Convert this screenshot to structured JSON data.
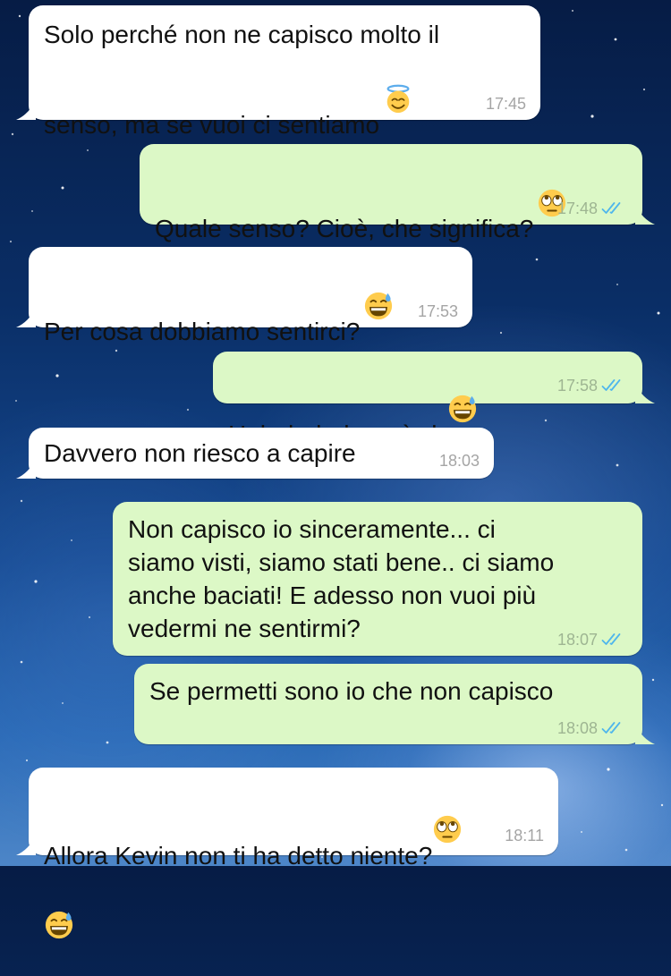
{
  "chat": {
    "messages": [
      {
        "direction": "in",
        "text": "Solo perché non ne capisco molto il\nsenso, ma se vuoi ci sentiamo",
        "emoji_icon": "smiling-face-with-halo",
        "time": "17:45"
      },
      {
        "direction": "out",
        "text": "Quale senso? Cioè, che significa?",
        "emoji_icon": "face-with-rolling-eyes",
        "time": "17:48",
        "status_icon": "double-check-read"
      },
      {
        "direction": "in",
        "text": "Per cosa dobbiamo sentirci?",
        "emoji_icon": "grinning-face-with-sweat",
        "time": "17:53"
      },
      {
        "direction": "out",
        "text": "Hahahahah così ok",
        "emoji_icon": "grinning-face-with-sweat",
        "time": "17:58",
        "status_icon": "double-check-read"
      },
      {
        "direction": "in",
        "text": "Davvero non riesco a capire",
        "time": "18:03"
      },
      {
        "direction": "out",
        "text": "Non capisco io sinceramente... ci\nsiamo visti, siamo stati bene.. ci siamo\nanche baciati! E adesso non vuoi più\nvedermi ne sentirmi?",
        "time": "18:07",
        "status_icon": "double-check-read"
      },
      {
        "direction": "out",
        "text": "Se permetti sono io che non capisco",
        "time": "18:08",
        "status_icon": "double-check-read"
      },
      {
        "direction": "in",
        "text": "Allora Kevin non ti ha detto niente?",
        "emoji_icon": "face-with-rolling-eyes",
        "emoji2_icon": "grinning-face-with-sweat",
        "time": "18:11"
      }
    ]
  },
  "colors": {
    "incoming_bubble": "#ffffff",
    "outgoing_bubble": "#dcf8c6",
    "read_ticks": "#4fb6ec",
    "timestamp": "#a5a5a5",
    "background_top": "#061c45",
    "background_bottom": "#4d86c8"
  }
}
